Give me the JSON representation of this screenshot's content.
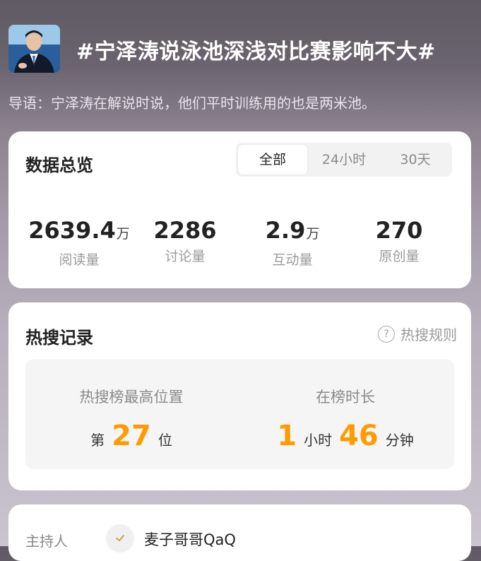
{
  "topic": {
    "title": "#宁泽涛说泳池深浅对比赛影响不大#",
    "intro": "导语：宁泽涛在解说时说，他们平时训练用的也是两米池。"
  },
  "overview": {
    "title": "数据总览",
    "tabs": [
      {
        "label": "全部",
        "active": true
      },
      {
        "label": "24小时",
        "active": false
      },
      {
        "label": "30天",
        "active": false
      }
    ],
    "stats": [
      {
        "value": "2639.4",
        "unit": "万",
        "label": "阅读量"
      },
      {
        "value": "2286",
        "unit": "",
        "label": "讨论量"
      },
      {
        "value": "2.9",
        "unit": "万",
        "label": "互动量"
      },
      {
        "value": "270",
        "unit": "",
        "label": "原创量"
      }
    ]
  },
  "hot_search": {
    "title": "热搜记录",
    "rules_label": "热搜规则",
    "rules_icon": "?",
    "best_position": {
      "label": "热搜榜最高位置",
      "prefix": "第",
      "value": "27",
      "suffix": "位"
    },
    "duration": {
      "label": "在榜时长",
      "hours": "1",
      "hours_unit": "小时",
      "minutes": "46",
      "minutes_unit": "分钟"
    },
    "accent_color": "#ff9b00"
  },
  "host": {
    "label": "主持人",
    "name": "麦子哥哥QaQ"
  }
}
